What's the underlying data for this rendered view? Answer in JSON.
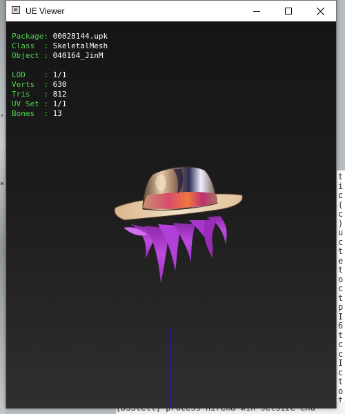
{
  "window": {
    "title": "UE Viewer",
    "controls": {
      "minimize": "—",
      "maximize": "☐",
      "close": "✕"
    }
  },
  "info_panel": {
    "group1": [
      {
        "key": "Package",
        "sep": ": ",
        "value": "00028144.upk"
      },
      {
        "key": "Class  ",
        "sep": ": ",
        "value": "SkeletalMesh"
      },
      {
        "key": "Object ",
        "sep": ": ",
        "value": "040164_JinM"
      }
    ],
    "group2": [
      {
        "key": "LOD    ",
        "sep": ": ",
        "value": "1/1"
      },
      {
        "key": "Verts  ",
        "sep": ": ",
        "value": "630"
      },
      {
        "key": "Tris   ",
        "sep": ": ",
        "value": "812"
      },
      {
        "key": "UV Set ",
        "sep": ": ",
        "value": "1/1"
      },
      {
        "key": "Bones  ",
        "sep": ": ",
        "value": "13"
      }
    ]
  },
  "background_console": {
    "right_edge_chars": [
      "t",
      "i",
      "c",
      "(",
      "c",
      ")",
      "u",
      "c",
      "t",
      "e",
      "t",
      "o",
      "c",
      "t",
      "p",
      "I",
      "6",
      "t",
      "c",
      "c",
      "I",
      "c",
      "t",
      "o",
      "t",
      "I"
    ],
    "bottom_line": "[DSStell] process  hirema win setsize  end"
  },
  "colors": {
    "label_green": "#4fd14f",
    "value_white": "#ffffff",
    "viewport_top": "#151515",
    "viewport_bottom": "#2f2f2f",
    "axis_blue": "#1a1acc"
  }
}
